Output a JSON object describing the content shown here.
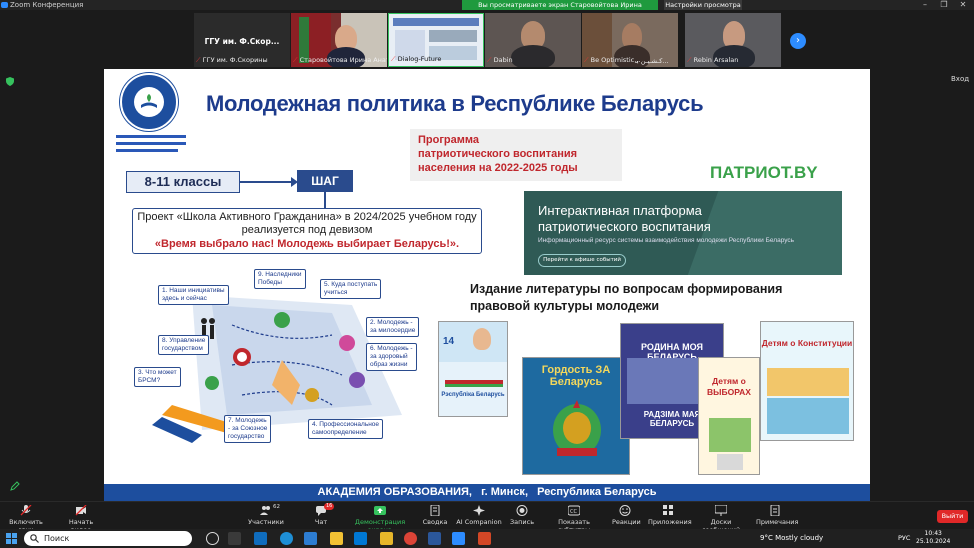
{
  "window": {
    "title": "Zoom Конференция",
    "share_banner": "Вы просматриваете экран Старовойтова Ирина Анатольевна",
    "view_settings": "Настройки просмотра"
  },
  "participants": [
    {
      "center_name": "ГГУ им. Ф.Скор...",
      "name": "ГГУ им. Ф.Скорины"
    },
    {
      "center_name": "",
      "name": "Старовойтова Ирина Анатол..."
    },
    {
      "center_name": "",
      "name": "Dialog-Future"
    },
    {
      "center_name": "",
      "name": "Dabin"
    },
    {
      "center_name": "",
      "name": "Be Optimistic..."
    },
    {
      "center_name": "",
      "name": "كـشـيـن بـ..."
    },
    {
      "center_name": "",
      "name": "Rebin Arsalan"
    }
  ],
  "side": {
    "enter_label": "Вход"
  },
  "slide": {
    "title": "Молодежная политика в Республике Беларусь",
    "program_lines": [
      "Программа",
      "патриотического воспитания",
      "населения на 2022-2025 годы"
    ],
    "patriot_logo": "ПАТРИОТ.BY",
    "grade": "8-11 классы",
    "step": "ШАГ",
    "project_line1": "Проект «Школа Активного Гражданина» в 2024/2025 учебном году",
    "project_line2": "реализуется под девизом",
    "project_motto": "«Время выбрало нас! Молодежь выбирает Беларусь!».",
    "platform_title_1": "Интерактивная платформа",
    "platform_title_2": "патриотического воспитания",
    "platform_sub": "Информационный ресурс системы взаимодействия молодежи Республики Беларусь",
    "platform_btn": "Перейти к афише событий",
    "literature_line1": "Издание литературы по вопросам формирования",
    "literature_line2": "правовой культуры молодежи",
    "info_labels": [
      "1. Наши инициативы",
      "здесь и сейчас",
      "9. Наследники",
      "Победы",
      "5. Куда поступать",
      "учиться",
      "8. Управление",
      "государством",
      "2. Молодежь -",
      "за милосердие",
      "6. Молодежь -",
      "за здоровый",
      "образ жизни",
      "3. Что может",
      "БРСМ?",
      "7. Молодежь",
      "- за Союзное",
      "государство",
      "4. Профессиональное",
      "самоопределение"
    ],
    "books": [
      {
        "title": "Рэспубліка Беларусь",
        "number": "14"
      },
      {
        "title": "Гордость ЗА Беларусь"
      },
      {
        "title": "РОДИНА МОЯ БЕЛАРУСЬ",
        "sub": "РАДЗІМА МАЯ БЕЛАРУСЬ"
      },
      {
        "title": "Детям о ВЫБОРАХ"
      },
      {
        "title": "Детям о Конституции"
      }
    ],
    "footer_org": "АКАДЕМИЯ ОБРАЗОВАНИЯ,",
    "footer_city": "г. Минск,",
    "footer_country": "Республика Беларусь"
  },
  "toolbar": [
    {
      "label": "Включить звук"
    },
    {
      "label": "Начать видео"
    },
    {
      "label": "Участники",
      "count": "62"
    },
    {
      "label": "Чат",
      "count": "16"
    },
    {
      "label": "Демонстрация экрана"
    },
    {
      "label": "Сводка"
    },
    {
      "label": "AI Companion"
    },
    {
      "label": "Запись"
    },
    {
      "label": "Показать субтитры"
    },
    {
      "label": "Реакции"
    },
    {
      "label": "Приложения"
    },
    {
      "label": "Доски сообщений"
    },
    {
      "label": "Примечания"
    }
  ],
  "leave_label": "Выйти",
  "taskbar": {
    "search_placeholder": "Поиск",
    "weather": "9°C  Mostly cloudy",
    "lang": "РУС",
    "time": "10:43",
    "date": "25.10.2024"
  },
  "colors": {
    "zoom_blue": "#2d8cff",
    "share_green": "#1f9a3e",
    "slide_blue": "#1d4e9e",
    "title_blue": "#1d3b8c",
    "motto_red": "#c0272d",
    "patriot_green": "#3aa14a",
    "leave_red": "#e02828"
  }
}
